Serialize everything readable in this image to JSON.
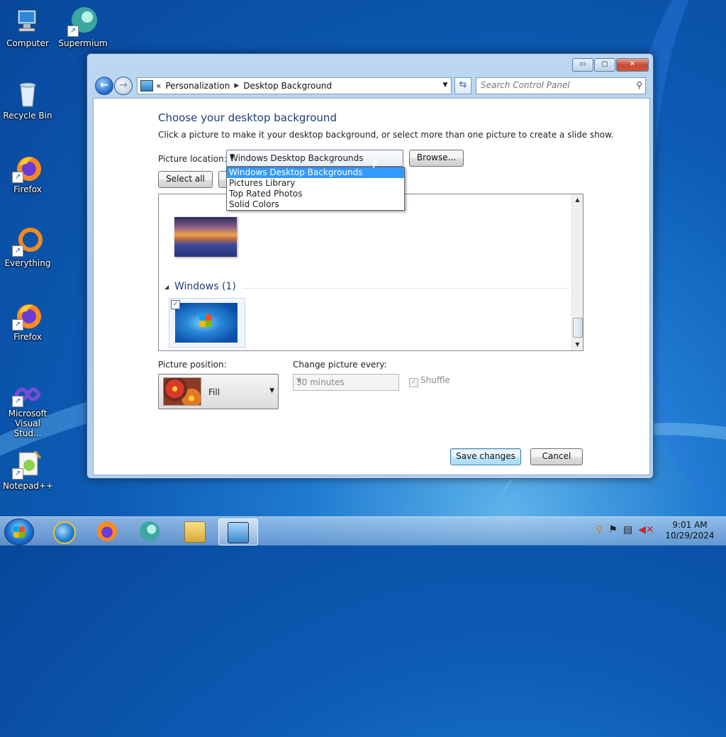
{
  "desktop": {
    "icons": [
      {
        "label": "Computer",
        "icon": "computer-icon"
      },
      {
        "label": "Supermium",
        "icon": "supermium-icon"
      },
      {
        "label": "Recycle Bin",
        "icon": "recycle-bin-icon"
      },
      {
        "label": "Firefox",
        "icon": "firefox-icon"
      },
      {
        "label": "Everything",
        "icon": "everything-icon"
      },
      {
        "label": "Firefox",
        "icon": "firefox-icon"
      },
      {
        "label": "Microsoft Visual Stud...",
        "icon": "visual-studio-icon"
      },
      {
        "label": "Notepad++",
        "icon": "notepadpp-icon"
      }
    ]
  },
  "window": {
    "controls": {
      "minimize": "▭",
      "maximize": "▢",
      "close": "✕"
    },
    "address": {
      "prefix": "«",
      "breadcrumbs": [
        "Personalization",
        "Desktop Background"
      ],
      "search_placeholder": "Search Control Panel"
    },
    "heading": "Choose your desktop background",
    "subtext": "Click a picture to make it your desktop background, or select more than one picture to create a slide show.",
    "picture_location": {
      "label": "Picture location:",
      "selected": "Windows Desktop Backgrounds",
      "options": [
        "Windows Desktop Backgrounds",
        "Pictures Library",
        "Top Rated Photos",
        "Solid Colors"
      ],
      "highlighted_index": 0
    },
    "browse_label": "Browse...",
    "select_all_label": "Select all",
    "gallery": {
      "group_title": "Windows (1)",
      "checked": "✓"
    },
    "picture_position": {
      "label": "Picture position:",
      "value": "Fill"
    },
    "change_picture": {
      "label": "Change picture every:",
      "value": "30 minutes"
    },
    "shuffle": {
      "label": "Shuffle",
      "checked": true
    },
    "save_label": "Save changes",
    "cancel_label": "Cancel"
  },
  "taskbar": {
    "items": [
      "start-button",
      "internet-explorer-icon",
      "firefox-icon",
      "supermium-icon",
      "file-explorer-icon",
      "control-panel-icon"
    ],
    "clock": {
      "time": "9:01 AM",
      "date": "10/29/2024"
    }
  }
}
